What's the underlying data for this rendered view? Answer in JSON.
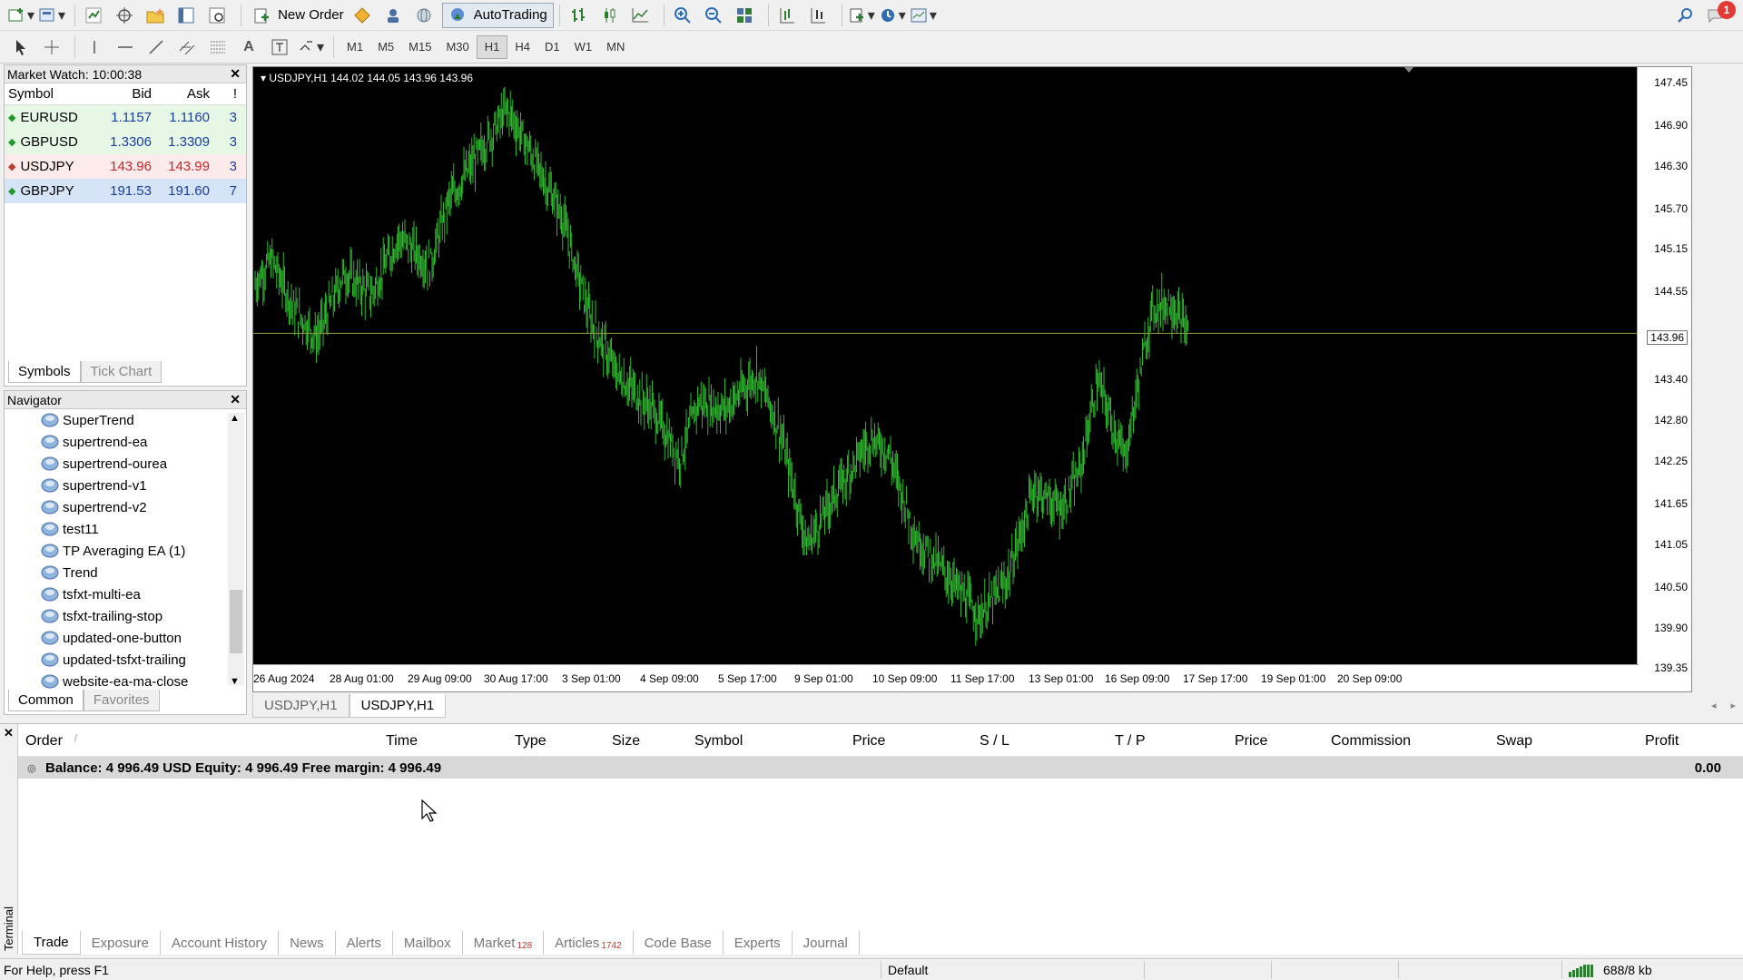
{
  "toolbar": {
    "new_order_label": "New Order",
    "autotrading_label": "AutoTrading",
    "notification_count": "1"
  },
  "timeframes": [
    "M1",
    "M5",
    "M15",
    "M30",
    "H1",
    "H4",
    "D1",
    "W1",
    "MN"
  ],
  "timeframe_active": "H1",
  "market_watch": {
    "title": "Market Watch: 10:00:38",
    "headers": {
      "symbol": "Symbol",
      "bid": "Bid",
      "ask": "Ask",
      "spread": "!"
    },
    "rows": [
      {
        "symbol": "EURUSD",
        "bid": "1.1157",
        "ask": "1.1160",
        "spread": "3",
        "direction": "up",
        "bg": "#e6f7e6"
      },
      {
        "symbol": "GBPUSD",
        "bid": "1.3306",
        "ask": "1.3309",
        "spread": "3",
        "direction": "up",
        "bg": "#e6f7e6"
      },
      {
        "symbol": "USDJPY",
        "bid": "143.96",
        "ask": "143.99",
        "spread": "3",
        "direction": "down",
        "bg": "#fdeaea"
      },
      {
        "symbol": "GBPJPY",
        "bid": "191.53",
        "ask": "191.60",
        "spread": "7",
        "direction": "up",
        "bg": "#d6e4f7"
      }
    ],
    "tabs": [
      "Symbols",
      "Tick Chart"
    ]
  },
  "navigator": {
    "title": "Navigator",
    "items": [
      "SuperTrend",
      "supertrend-ea",
      "supertrend-ourea",
      "supertrend-v1",
      "supertrend-v2",
      "test11",
      "TP Averaging EA (1)",
      "Trend",
      "tsfxt-multi-ea",
      "tsfxt-trailing-stop",
      "updated-one-button",
      "updated-tsfxt-trailing",
      "website-ea-ma-close"
    ],
    "tabs": [
      "Common",
      "Favorites"
    ]
  },
  "chart": {
    "title": "USDJPY,H1  144.02 144.05 143.96 143.96",
    "current_price": "143.96",
    "price_labels": [
      "147.45",
      "146.90",
      "146.30",
      "145.70",
      "145.15",
      "144.55",
      "143.96",
      "143.40",
      "142.80",
      "142.25",
      "141.65",
      "141.05",
      "140.50",
      "139.90",
      "139.35"
    ],
    "time_labels": [
      "26 Aug 2024",
      "28 Aug 01:00",
      "29 Aug 09:00",
      "30 Aug 17:00",
      "3 Sep 01:00",
      "4 Sep 09:00",
      "5 Sep 17:00",
      "9 Sep 01:00",
      "10 Sep 09:00",
      "11 Sep 17:00",
      "13 Sep 01:00",
      "16 Sep 09:00",
      "17 Sep 17:00",
      "19 Sep 01:00",
      "20 Sep 09:00"
    ],
    "bar_color": "#2fb82f",
    "bid_line_color": "#8a9a3a"
  },
  "chart_tabs": [
    "USDJPY,H1",
    "USDJPY,H1"
  ],
  "terminal": {
    "headers": [
      "Order",
      "Time",
      "Type",
      "Size",
      "Symbol",
      "Price",
      "S / L",
      "T / P",
      "Price",
      "Commission",
      "Swap",
      "Profit"
    ],
    "balance_text": "Balance: 4 996.49 USD  Equity: 4 996.49  Free margin: 4 996.49",
    "profit": "0.00",
    "side_label": "Terminal",
    "tabs": [
      {
        "label": "Trade",
        "badge": ""
      },
      {
        "label": "Exposure",
        "badge": ""
      },
      {
        "label": "Account History",
        "badge": ""
      },
      {
        "label": "News",
        "badge": ""
      },
      {
        "label": "Alerts",
        "badge": ""
      },
      {
        "label": "Mailbox",
        "badge": ""
      },
      {
        "label": "Market",
        "badge": "128"
      },
      {
        "label": "Articles",
        "badge": "1742"
      },
      {
        "label": "Code Base",
        "badge": ""
      },
      {
        "label": "Experts",
        "badge": ""
      },
      {
        "label": "Journal",
        "badge": ""
      }
    ]
  },
  "status": {
    "help": "For Help, press F1",
    "profile": "Default",
    "traffic": "688/8 kb"
  }
}
